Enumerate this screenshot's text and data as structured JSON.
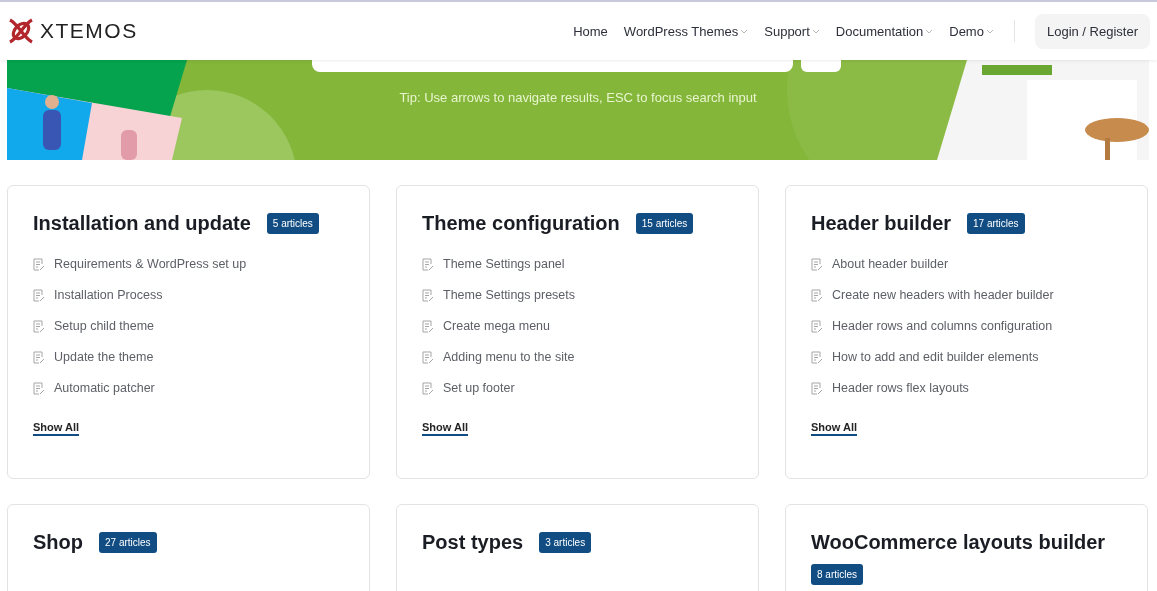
{
  "header": {
    "logo": "XTEMOS",
    "nav": [
      {
        "label": "Home",
        "dropdown": false
      },
      {
        "label": "WordPress Themes",
        "dropdown": true
      },
      {
        "label": "Support",
        "dropdown": true
      },
      {
        "label": "Documentation",
        "dropdown": true
      },
      {
        "label": "Demo",
        "dropdown": true
      }
    ],
    "login": "Login / Register"
  },
  "banner": {
    "tip": "Tip: Use arrows to navigate results, ESC to focus search input"
  },
  "sections": [
    {
      "title": "Installation and update",
      "badge": "5 articles",
      "articles": [
        "Requirements & WordPress set up",
        "Installation Process",
        "Setup child theme",
        "Update the theme",
        "Automatic patcher"
      ],
      "show_all": "Show All"
    },
    {
      "title": "Theme configuration",
      "badge": "15 articles",
      "articles": [
        "Theme Settings panel",
        "Theme Settings presets",
        "Create mega menu",
        "Adding menu to the site",
        "Set up footer"
      ],
      "show_all": "Show All"
    },
    {
      "title": "Header builder",
      "badge": "17 articles",
      "articles": [
        "About header builder",
        "Create new headers with header builder",
        "Header rows and columns configuration",
        "How to add and edit builder elements",
        "Header rows flex layouts"
      ],
      "show_all": "Show All"
    },
    {
      "title": "Shop",
      "badge": "27 articles"
    },
    {
      "title": "Post types",
      "badge": "3 articles"
    },
    {
      "title": "WooCommerce layouts builder",
      "badge": "8 articles"
    }
  ]
}
